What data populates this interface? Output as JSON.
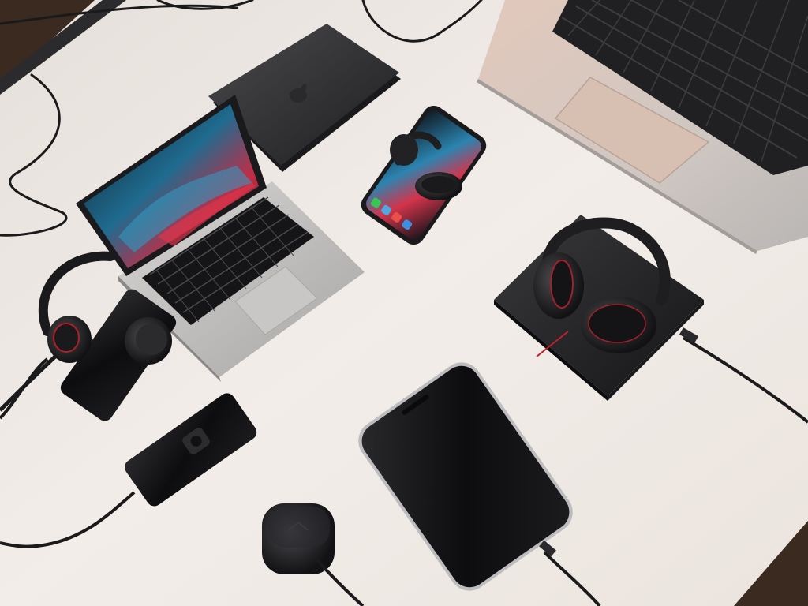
{
  "scene": {
    "description_tag": "",
    "colors": {
      "desk": "#efe9e4",
      "desk_shadow": "#d9d1ca",
      "floor": "#3a2a20",
      "device_dark": "#1c1c1e",
      "device_mid": "#2c2c2e",
      "aluminum": "#bdbcbc",
      "aluminum_light": "#d6d4d2",
      "rose_aluminum": "#d8c3b8",
      "key": "#1a1a1a",
      "screen_blue": "#2a7ea8",
      "screen_red": "#d6344a",
      "accent_red": "#c0202a",
      "cable": "#1a1a1a"
    },
    "objects": [
      {
        "name": "large-laptop",
        "icon": "laptop-icon"
      },
      {
        "name": "small-laptop",
        "icon": "laptop-icon"
      },
      {
        "name": "closed-laptop-lid",
        "icon": "apple-logo-icon"
      },
      {
        "name": "phone-top",
        "icon": "smartphone-icon"
      },
      {
        "name": "phone-bottom",
        "icon": "smartphone-icon"
      },
      {
        "name": "headphones-on-stand",
        "icon": "headphones-icon"
      },
      {
        "name": "headphones-left",
        "icon": "headphones-icon"
      },
      {
        "name": "earbuds-case",
        "icon": "earbuds-case-icon"
      },
      {
        "name": "usb-dongle",
        "icon": "usb-device-icon"
      }
    ]
  }
}
